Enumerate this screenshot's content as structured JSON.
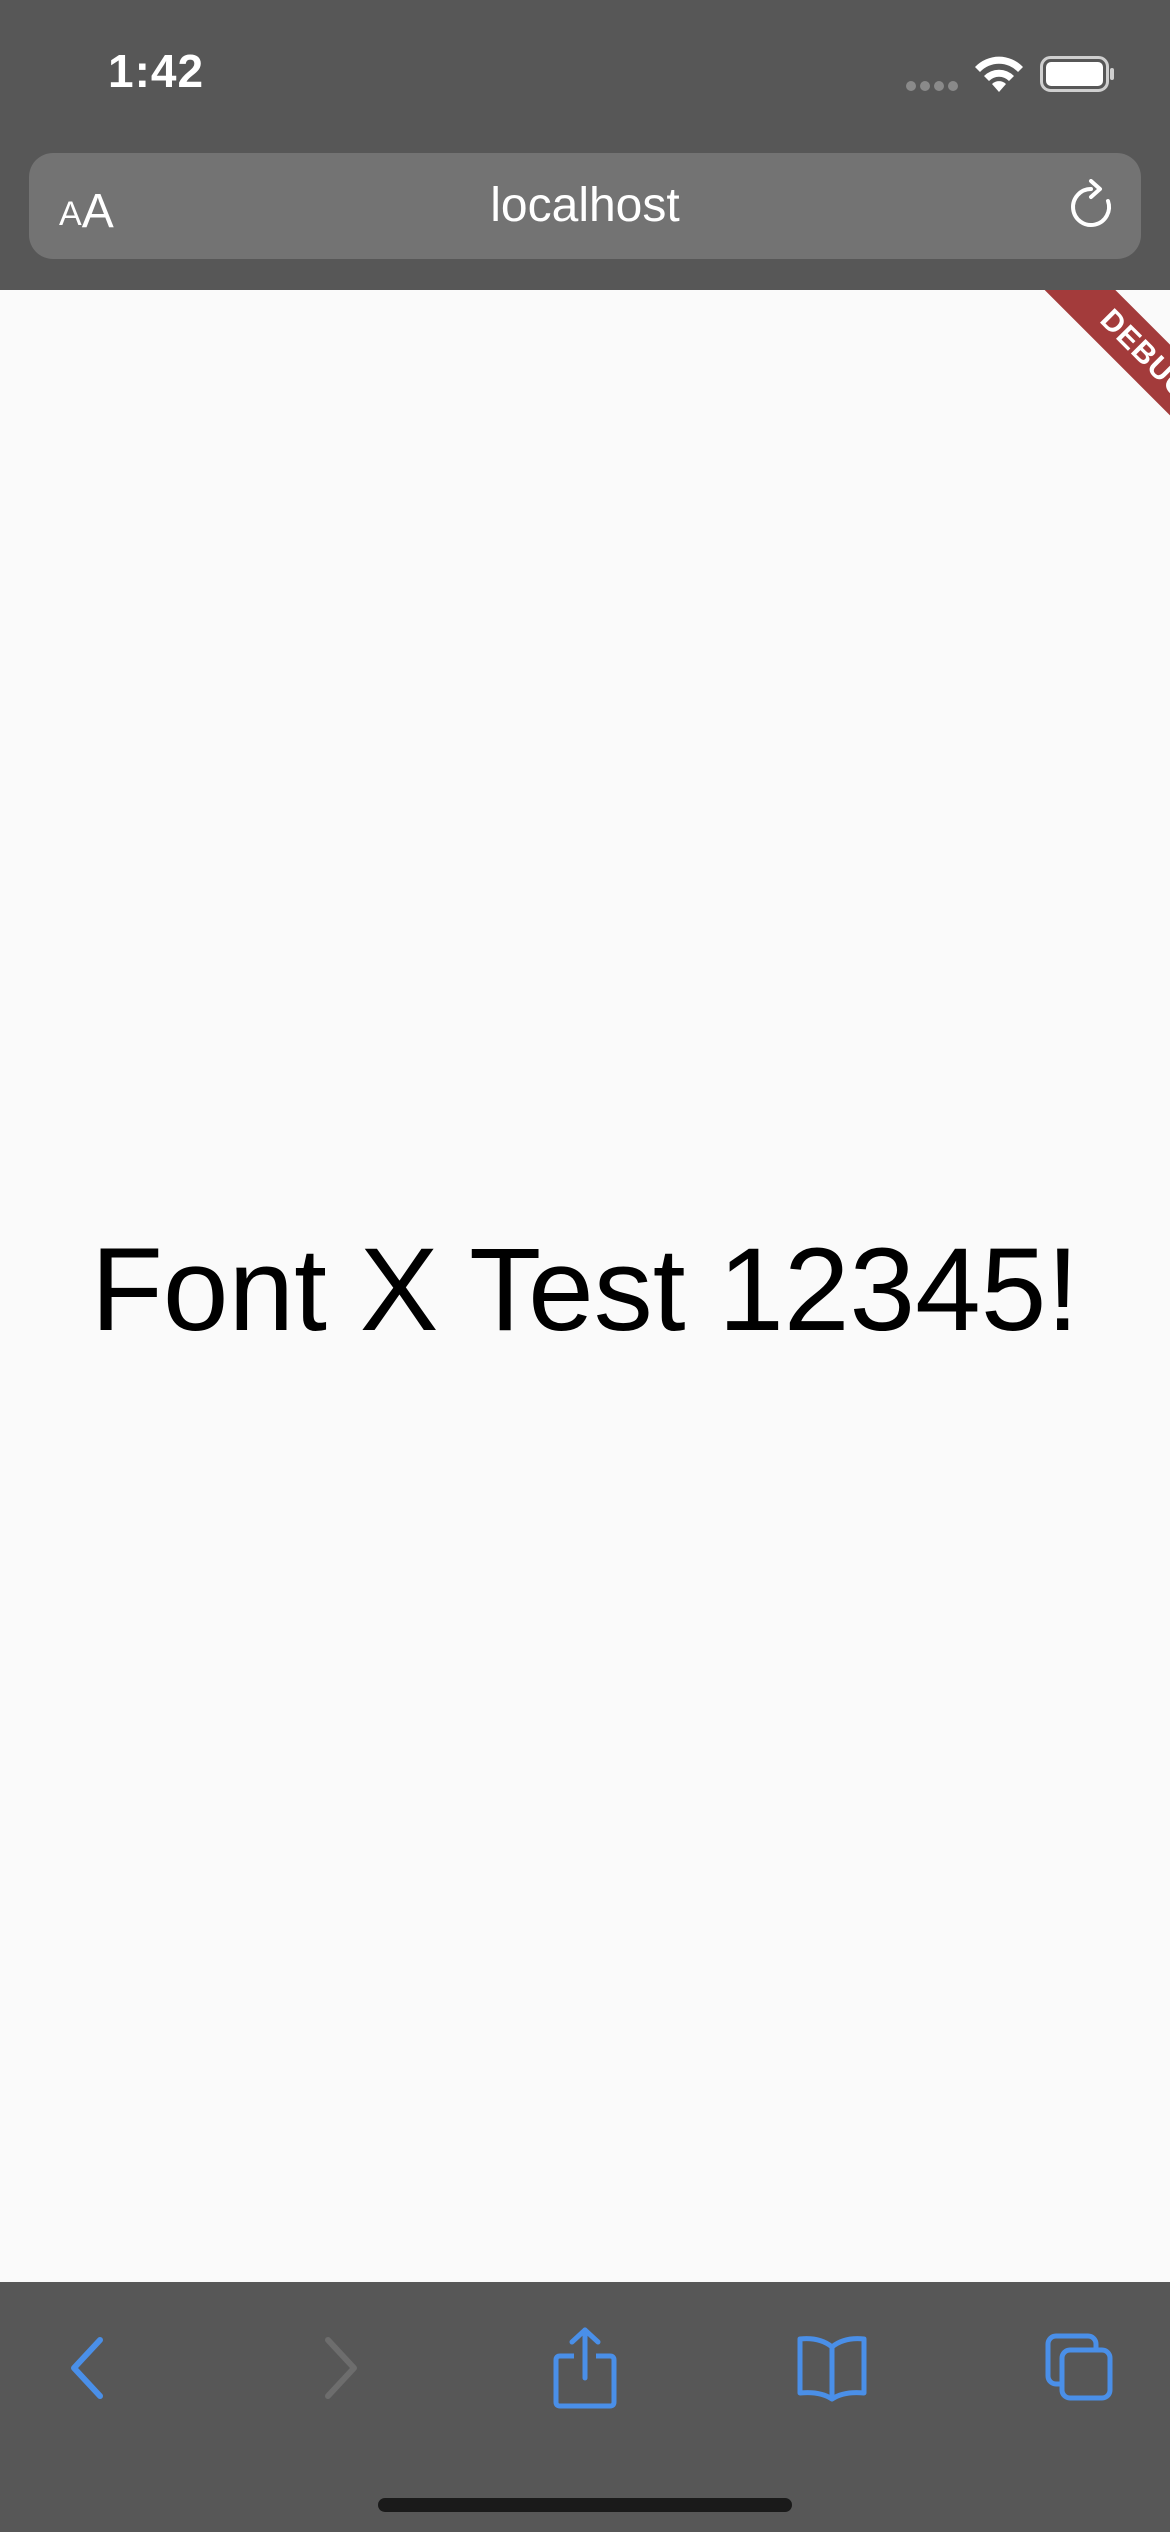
{
  "status_bar": {
    "time": "1:42"
  },
  "browser": {
    "text_size_small": "A",
    "text_size_large": "A",
    "url": "localhost",
    "icons": {
      "reload": "reload-icon",
      "back": "chevron-left-icon",
      "forward": "chevron-right-icon",
      "share": "share-icon",
      "bookmarks": "book-icon",
      "tabs": "tabs-icon"
    }
  },
  "page": {
    "headline": "Font X Test 12345!",
    "debug_banner": "DEBUG"
  },
  "colors": {
    "chrome_bg": "#575757",
    "address_bar_bg": "#737373",
    "accent_blue": "#4a8fe8",
    "disabled_gray": "#6d6d6d",
    "debug_red": "#a33b3b",
    "page_bg": "#fafafa"
  }
}
